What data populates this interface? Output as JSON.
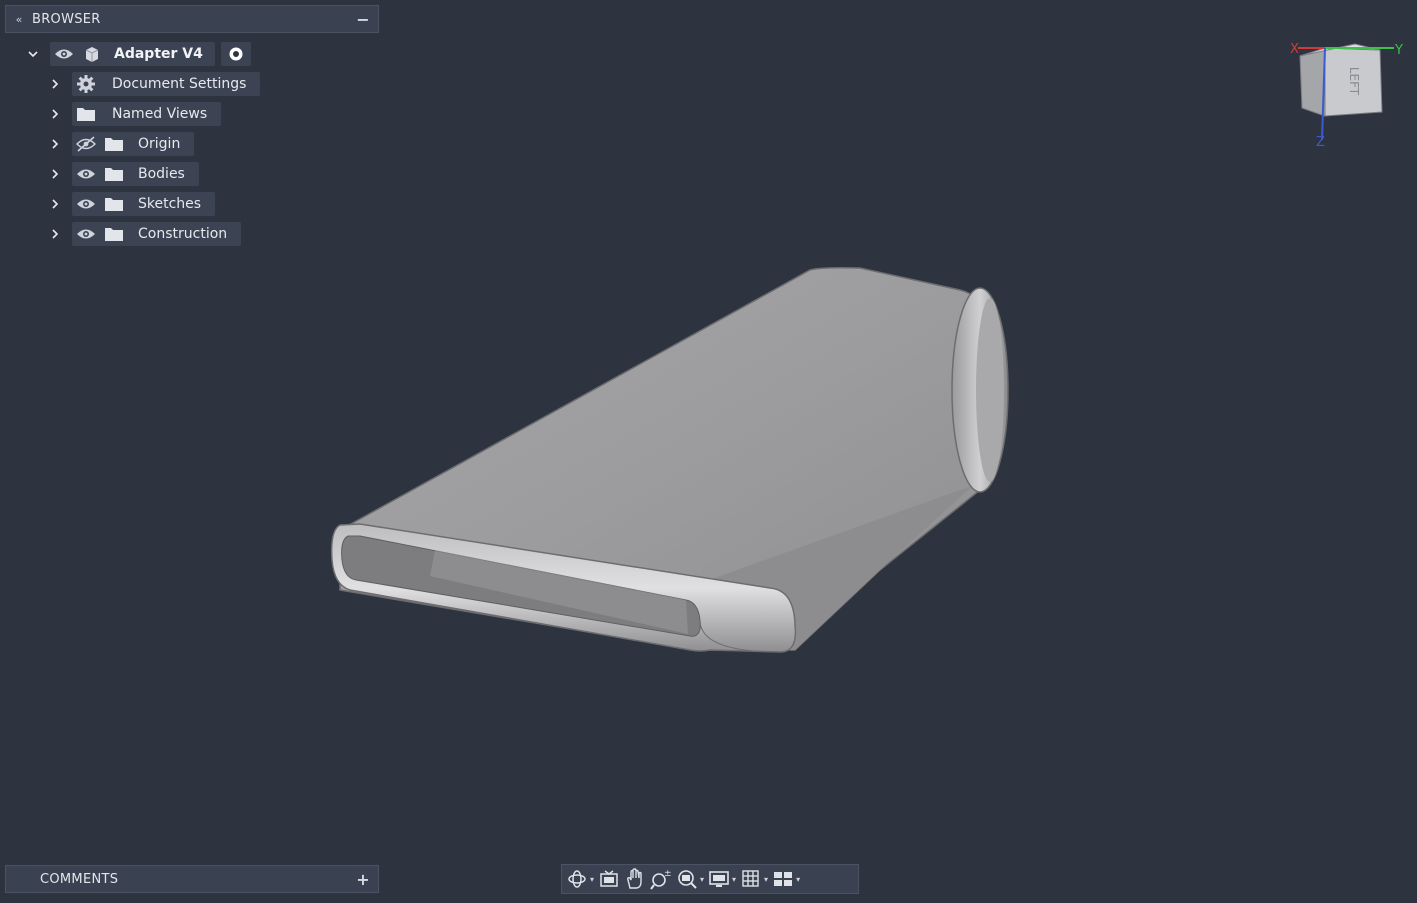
{
  "browser": {
    "title": "BROWSER",
    "collapse_glyph": "«",
    "minimize_glyph": "−",
    "root": {
      "label": "Adapter V4"
    },
    "items": [
      {
        "label": "Document Settings",
        "icon": "gear-icon"
      },
      {
        "label": "Named Views",
        "icon": "folder-icon"
      },
      {
        "label": "Origin",
        "icon": "folder-icon",
        "visibility": "hidden"
      },
      {
        "label": "Bodies",
        "icon": "folder-icon",
        "visibility": "visible"
      },
      {
        "label": "Sketches",
        "icon": "folder-icon",
        "visibility": "visible"
      },
      {
        "label": "Construction",
        "icon": "folder-icon",
        "visibility": "visible"
      }
    ]
  },
  "comments": {
    "title": "COMMENTS",
    "add_glyph": "+"
  },
  "viewcube": {
    "face_label": "LEFT",
    "axis_x": "X",
    "axis_y": "Y",
    "axis_z": "Z"
  },
  "toolbar": {
    "tools": [
      "orbit-icon",
      "look-at-icon",
      "pan-icon",
      "zoom-icon",
      "zoom-window-icon",
      "display-settings-icon",
      "grid-icon",
      "viewports-icon"
    ]
  },
  "colors": {
    "background": "#2e3340",
    "panel": "#3a4150",
    "axis_x": "#d23a3a",
    "axis_y": "#3ac24a",
    "axis_z": "#3a5ad2"
  }
}
